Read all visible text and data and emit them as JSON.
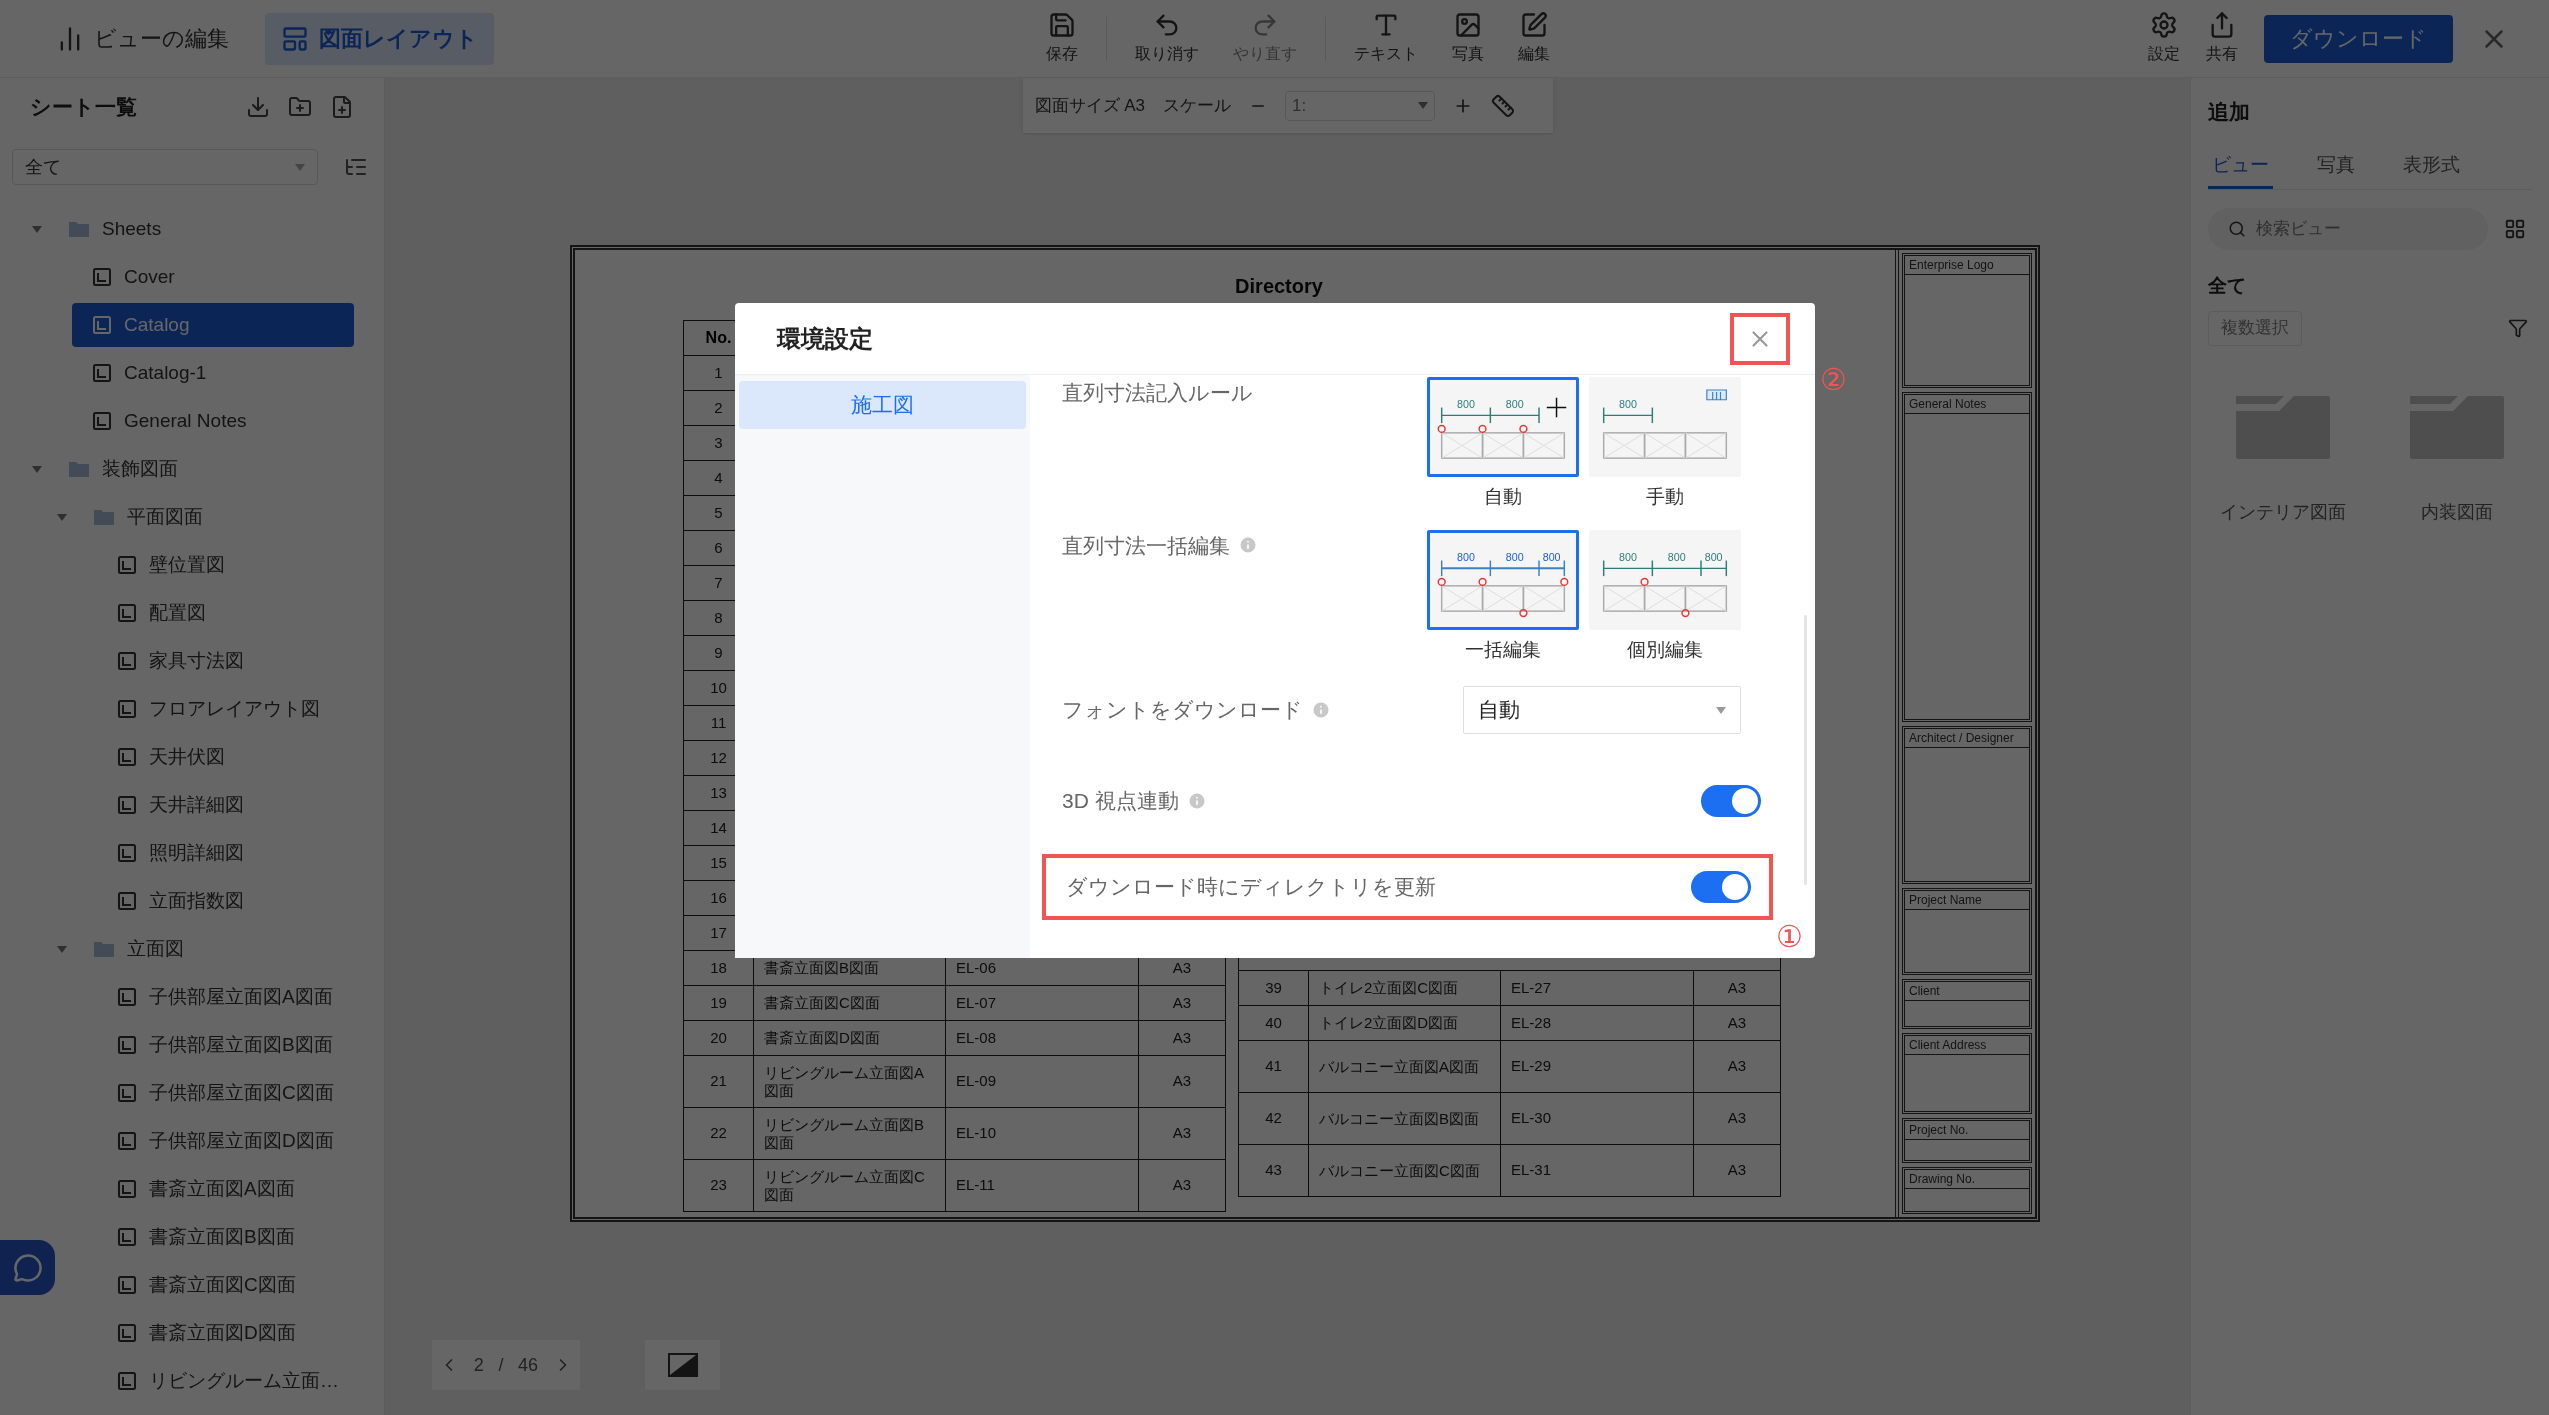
{
  "toolbar": {
    "modes": [
      {
        "label": "ビューの編集",
        "kind": "view",
        "selected": false
      },
      {
        "label": "図面レイアウト",
        "kind": "layout",
        "selected": true
      }
    ],
    "tools": [
      {
        "label": "保存",
        "kind": "save",
        "disabled": false
      },
      {
        "label": "取り消す",
        "kind": "undo",
        "disabled": false
      },
      {
        "label": "やり直す",
        "kind": "redo",
        "disabled": true
      },
      {
        "label": "テキスト",
        "kind": "text",
        "disabled": false
      },
      {
        "label": "写真",
        "kind": "photo",
        "disabled": false
      },
      {
        "label": "編集",
        "kind": "edit",
        "disabled": false
      }
    ],
    "right_tools": [
      {
        "label": "設定",
        "kind": "settings"
      },
      {
        "label": "共有",
        "kind": "share"
      }
    ],
    "download_button": "ダウンロード"
  },
  "sidebar": {
    "title": "シート一覧",
    "filter": "全て",
    "tree": [
      {
        "label": "Sheets",
        "kind": "folder",
        "expanded": true,
        "children": [
          {
            "label": "Cover",
            "kind": "sheet",
            "selected": false
          },
          {
            "label": "Catalog",
            "kind": "sheet",
            "selected": true
          },
          {
            "label": "Catalog-1",
            "kind": "sheet",
            "selected": false
          },
          {
            "label": "General Notes",
            "kind": "sheet",
            "selected": false
          }
        ]
      },
      {
        "label": "装飾図面",
        "kind": "folder",
        "expanded": true,
        "children": [
          {
            "label": "平面図面",
            "kind": "folder",
            "expanded": true,
            "children": [
              {
                "label": "壁位置図",
                "kind": "sheet",
                "selected": false
              },
              {
                "label": "配置図",
                "kind": "sheet",
                "selected": false
              },
              {
                "label": "家具寸法図",
                "kind": "sheet",
                "selected": false
              },
              {
                "label": "フロアレイアウト図",
                "kind": "sheet",
                "selected": false
              },
              {
                "label": "天井伏図",
                "kind": "sheet",
                "selected": false
              },
              {
                "label": "天井詳細図",
                "kind": "sheet",
                "selected": false
              },
              {
                "label": "照明詳細図",
                "kind": "sheet",
                "selected": false
              },
              {
                "label": "立面指数図",
                "kind": "sheet",
                "selected": false
              }
            ]
          },
          {
            "label": "立面図",
            "kind": "folder",
            "expanded": true,
            "children": [
              {
                "label": "子供部屋立面図A図面",
                "kind": "sheet",
                "selected": false
              },
              {
                "label": "子供部屋立面図B図面",
                "kind": "sheet",
                "selected": false
              },
              {
                "label": "子供部屋立面図C図面",
                "kind": "sheet",
                "selected": false
              },
              {
                "label": "子供部屋立面図D図面",
                "kind": "sheet",
                "selected": false
              },
              {
                "label": "書斎立面図A図面",
                "kind": "sheet",
                "selected": false
              },
              {
                "label": "書斎立面図B図面",
                "kind": "sheet",
                "selected": false
              },
              {
                "label": "書斎立面図C図面",
                "kind": "sheet",
                "selected": false
              },
              {
                "label": "書斎立面図D図面",
                "kind": "sheet",
                "selected": false
              },
              {
                "label": "リビングルーム立面…",
                "kind": "sheet",
                "selected": false
              }
            ]
          }
        ]
      }
    ]
  },
  "canvas_toolbar": {
    "page_size": "図面サイズ A3",
    "scale_label": "スケール",
    "scale_value": "1:"
  },
  "sheet": {
    "title": "Directory",
    "left_table": {
      "header": "No.",
      "rows": [
        {
          "no": "1"
        },
        {
          "no": "2"
        },
        {
          "no": "3"
        },
        {
          "no": "4"
        },
        {
          "no": "5"
        },
        {
          "no": "6"
        },
        {
          "no": "7"
        },
        {
          "no": "8"
        },
        {
          "no": "9"
        },
        {
          "no": "10"
        },
        {
          "no": "11"
        },
        {
          "no": "12"
        },
        {
          "no": "13"
        },
        {
          "no": "14"
        },
        {
          "no": "15"
        },
        {
          "no": "16"
        },
        {
          "no": "17"
        },
        {
          "no": "18",
          "name": "書斎立面図B図面",
          "code": "EL-06",
          "size": "A3"
        },
        {
          "no": "19",
          "name": "書斎立面図C図面",
          "code": "EL-07",
          "size": "A3"
        },
        {
          "no": "20",
          "name": "書斎立面図D図面",
          "code": "EL-08",
          "size": "A3"
        },
        {
          "no": "21",
          "name": "リビングルーム立面図A図面",
          "code": "EL-09",
          "size": "A3"
        },
        {
          "no": "22",
          "name": "リビングルーム立面図B図面",
          "code": "EL-10",
          "size": "A3"
        },
        {
          "no": "23",
          "name": "リビングルーム立面図C図面",
          "code": "EL-11",
          "size": "A3"
        }
      ]
    },
    "right_table": {
      "rows": [
        {
          "no": "39",
          "name": "トイレ2立面図C図面",
          "code": "EL-27",
          "size": "A3"
        },
        {
          "no": "40",
          "name": "トイレ2立面図D図面",
          "code": "EL-28",
          "size": "A3"
        },
        {
          "no": "41",
          "name": "バルコニー立面図A図面",
          "code": "EL-29",
          "size": "A3"
        },
        {
          "no": "42",
          "name": "バルコニー立面図B図面",
          "code": "EL-30",
          "size": "A3"
        },
        {
          "no": "43",
          "name": "バルコニー立面図C図面",
          "code": "EL-31",
          "size": "A3"
        }
      ]
    },
    "title_block": [
      "Enterprise Logo",
      "General Notes",
      "Architect / Designer",
      "Project Name",
      "Client",
      "Client Address",
      "Project No.",
      "Drawing No."
    ]
  },
  "pagination": {
    "current": "2",
    "separator": "/",
    "total": "46"
  },
  "right_panel": {
    "title": "追加",
    "tabs": [
      {
        "label": "ビュー",
        "selected": true
      },
      {
        "label": "写真",
        "selected": false
      },
      {
        "label": "表形式",
        "selected": false
      }
    ],
    "search": {
      "placeholder": "検索ビュー"
    },
    "section": "全て",
    "multi_select": "複数選択",
    "folders": [
      "インテリア図面",
      "内装図面"
    ]
  },
  "dialog": {
    "title": "環境設定",
    "close_marker": "②",
    "nav": [
      {
        "label": "施工図",
        "selected": true
      }
    ],
    "settings": [
      {
        "kind": "choice",
        "label": "直列寸法記入ルール",
        "info": false,
        "options": [
          {
            "label": "自動",
            "kind": "auto",
            "selected": true,
            "dims": [
              "800",
              "800"
            ]
          },
          {
            "label": "手動",
            "kind": "manual",
            "selected": false,
            "dims": [
              "800"
            ]
          }
        ]
      },
      {
        "kind": "choice",
        "label": "直列寸法一括編集",
        "info": true,
        "options": [
          {
            "label": "一括編集",
            "kind": "batch",
            "selected": true,
            "dims": [
              "800",
              "800",
              "800"
            ]
          },
          {
            "label": "個別編集",
            "kind": "single",
            "selected": false,
            "dims": [
              "800",
              "800",
              "800"
            ]
          }
        ]
      },
      {
        "kind": "select",
        "label": "フォントをダウンロード",
        "info": true,
        "value": "自動"
      },
      {
        "kind": "toggle",
        "label": "3D 視点連動",
        "info": true,
        "on": true
      },
      {
        "kind": "toggle",
        "label": "ダウンロード時にディレクトリを更新",
        "info": false,
        "on": true,
        "highlighted": true,
        "marker": "①"
      }
    ]
  }
}
